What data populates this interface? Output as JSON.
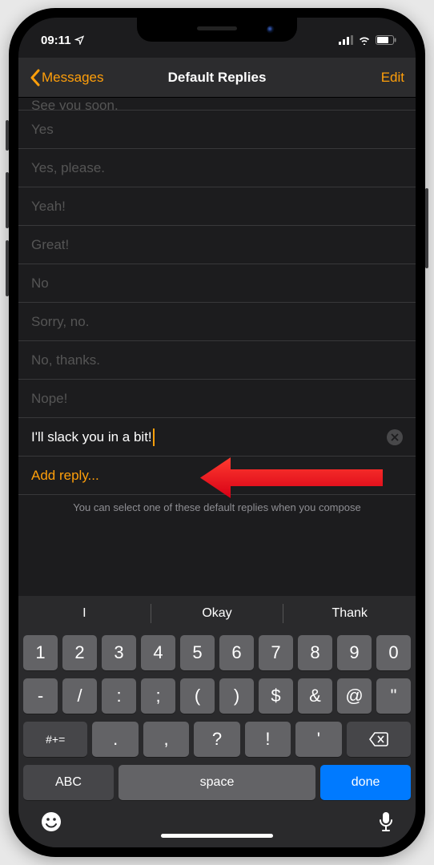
{
  "status": {
    "time": "09:11",
    "location_arrow": true
  },
  "nav": {
    "back_label": "Messages",
    "title": "Default Replies",
    "edit": "Edit"
  },
  "replies": [
    "See you soon.",
    "Yes",
    "Yes, please.",
    "Yeah!",
    "Great!",
    "No",
    "Sorry, no.",
    "No, thanks.",
    "Nope!"
  ],
  "editing_reply": "I'll slack you in a bit!",
  "add_reply_label": "Add reply...",
  "footer": "You can select one of these default replies when you compose",
  "suggestions": [
    "I",
    "Okay",
    "Thank"
  ],
  "keyboard": {
    "row1": [
      "1",
      "2",
      "3",
      "4",
      "5",
      "6",
      "7",
      "8",
      "9",
      "0"
    ],
    "row2": [
      "-",
      "/",
      ":",
      ";",
      "(",
      ")",
      "$",
      "&",
      "@",
      "\""
    ],
    "row3_shift": "#+=",
    "row3_keys": [
      ".",
      ",",
      "?",
      "!",
      "'"
    ],
    "row4_abc": "ABC",
    "row4_space": "space",
    "row4_done": "done"
  }
}
